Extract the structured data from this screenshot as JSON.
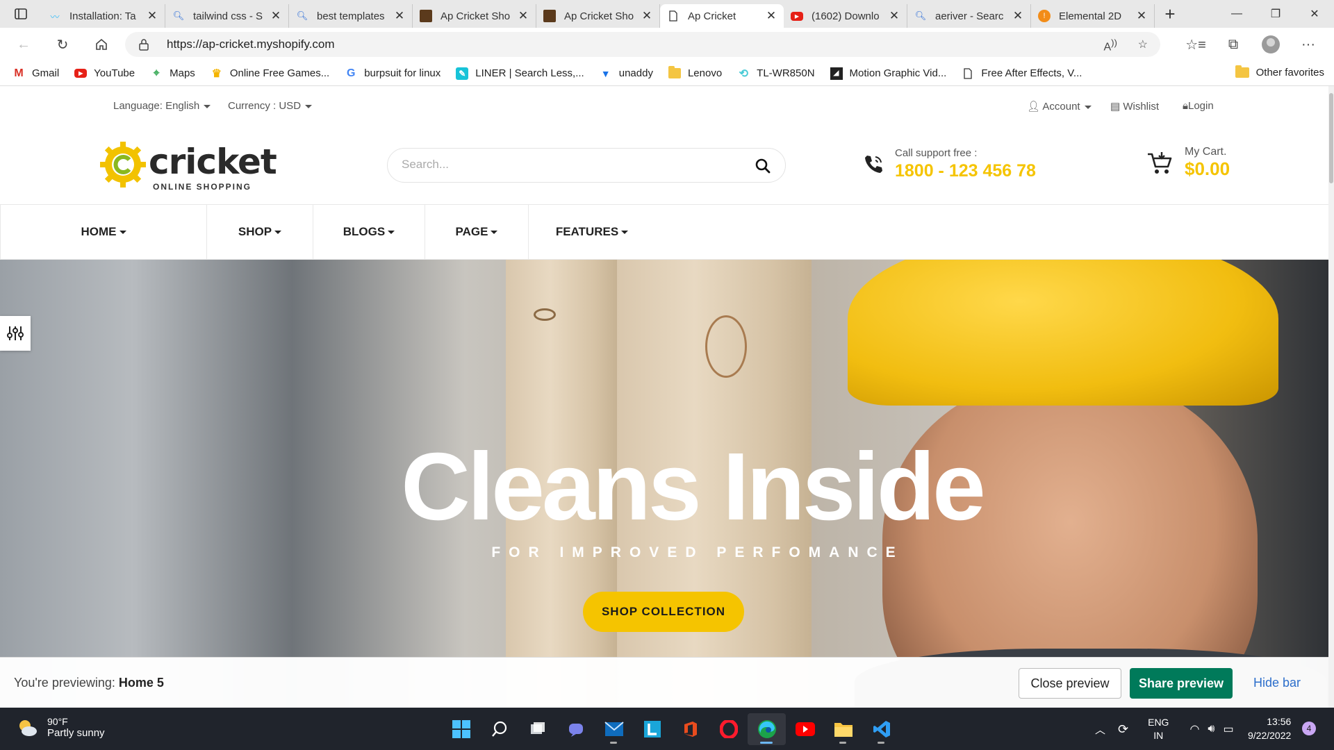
{
  "browser": {
    "tabs": [
      {
        "title": "Installation: Ta",
        "icon": "tailwind-icon"
      },
      {
        "title": "tailwind css - S",
        "icon": "search-icon"
      },
      {
        "title": "best templates",
        "icon": "search-icon"
      },
      {
        "title": "Ap Cricket Sho",
        "icon": "site-icon"
      },
      {
        "title": "Ap Cricket Sho",
        "icon": "site-icon"
      },
      {
        "title": "Ap Cricket",
        "icon": "page-icon",
        "active": true
      },
      {
        "title": "(1602) Downlo",
        "icon": "youtube-icon"
      },
      {
        "title": "aeriver - Searc",
        "icon": "search-icon"
      },
      {
        "title": "Elemental 2D",
        "icon": "elemental-icon"
      }
    ],
    "url": "https://ap-cricket.myshopify.com",
    "favorites": [
      {
        "label": "Gmail",
        "icon": "gmail-icon"
      },
      {
        "label": "YouTube",
        "icon": "youtube-icon"
      },
      {
        "label": "Maps",
        "icon": "maps-icon"
      },
      {
        "label": "Online Free Games...",
        "icon": "games-icon"
      },
      {
        "label": "burpsuit for linux",
        "icon": "google-icon"
      },
      {
        "label": "LINER | Search Less,...",
        "icon": "liner-icon"
      },
      {
        "label": "unaddy",
        "icon": "unaddy-icon"
      },
      {
        "label": "Lenovo",
        "icon": "folder-icon"
      },
      {
        "label": "TL-WR850N",
        "icon": "tplink-icon"
      },
      {
        "label": "Motion Graphic Vid...",
        "icon": "video-icon"
      },
      {
        "label": "Free After Effects, V...",
        "icon": "page-icon"
      }
    ],
    "other_favorites": "Other favorites"
  },
  "site": {
    "topbar": {
      "language": "Language: English",
      "currency": "Currency : USD",
      "account": "Account",
      "wishlist": "Wishlist",
      "login": "Login"
    },
    "logo": {
      "word": "cricket",
      "tagline": "ONLINE SHOPPING"
    },
    "search_placeholder": "Search...",
    "support": {
      "label": "Call support free :",
      "number": "1800 - 123 456 78"
    },
    "cart": {
      "label": "My Cart.",
      "amount": "$0.00"
    },
    "nav": [
      "HOME",
      "SHOP",
      "BLOGS",
      "PAGE",
      "FEATURES"
    ],
    "hero": {
      "title": "Cleans Inside",
      "subtitle": "FOR IMPROVED PERFOMANCE",
      "button": "SHOP COLLECTION"
    },
    "preview": {
      "prefix": "You're previewing:",
      "theme": "Home 5",
      "close": "Close preview",
      "share": "Share preview",
      "hide": "Hide bar"
    },
    "colors": {
      "accent": "#f5c400",
      "share_button": "#007a5a"
    }
  },
  "taskbar": {
    "weather_temp": "90°F",
    "weather_desc": "Partly sunny",
    "lang1": "ENG",
    "lang2": "IN",
    "time": "13:56",
    "date": "9/22/2022",
    "notifications": "4"
  }
}
